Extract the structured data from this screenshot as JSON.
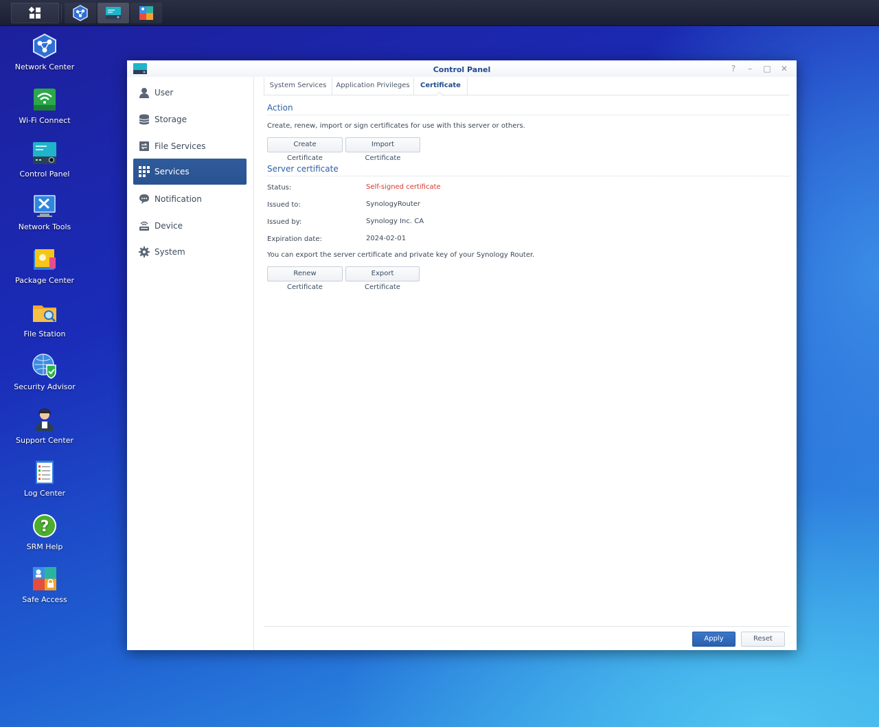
{
  "taskbar": {
    "items": [
      {
        "name": "main-menu"
      },
      {
        "name": "network-center"
      },
      {
        "name": "control-panel"
      },
      {
        "name": "safe-access"
      }
    ]
  },
  "desktop": {
    "icons": [
      {
        "label": "Network Center",
        "icon": "network-center-icon"
      },
      {
        "label": "Wi-Fi Connect",
        "icon": "wifi-connect-icon"
      },
      {
        "label": "Control Panel",
        "icon": "control-panel-icon"
      },
      {
        "label": "Network Tools",
        "icon": "network-tools-icon"
      },
      {
        "label": "Package Center",
        "icon": "package-center-icon"
      },
      {
        "label": "File Station",
        "icon": "file-station-icon"
      },
      {
        "label": "Security Advisor",
        "icon": "security-advisor-icon"
      },
      {
        "label": "Support Center",
        "icon": "support-center-icon"
      },
      {
        "label": "Log Center",
        "icon": "log-center-icon"
      },
      {
        "label": "SRM Help",
        "icon": "srm-help-icon"
      },
      {
        "label": "Safe Access",
        "icon": "safe-access-icon"
      }
    ]
  },
  "window": {
    "title": "Control Panel",
    "controls": {
      "help": "?",
      "minimize": "–",
      "maximize": "□",
      "close": "✕"
    }
  },
  "sidebar": {
    "items": [
      {
        "label": "User",
        "icon": "user-icon"
      },
      {
        "label": "Storage",
        "icon": "storage-icon"
      },
      {
        "label": "File Services",
        "icon": "file-services-icon"
      },
      {
        "label": "Services",
        "icon": "services-icon",
        "active": true
      },
      {
        "label": "Notification",
        "icon": "notification-icon"
      },
      {
        "label": "Device",
        "icon": "device-icon"
      },
      {
        "label": "System",
        "icon": "system-icon"
      }
    ]
  },
  "tabs": [
    {
      "label": "System Services"
    },
    {
      "label": "Application Privileges"
    },
    {
      "label": "Certificate",
      "active": true
    }
  ],
  "action": {
    "title": "Action",
    "description": "Create, renew, import or sign certificates for use with this server or others.",
    "create_button": "Create Certificate",
    "import_button": "Import Certificate"
  },
  "server_certificate": {
    "title": "Server certificate",
    "rows": [
      {
        "label": "Status:",
        "value": "Self-signed certificate"
      },
      {
        "label": "Issued to:",
        "value": "SynologyRouter"
      },
      {
        "label": "Issued by:",
        "value": "Synology Inc. CA"
      },
      {
        "label": "Expiration date:",
        "value": "2024-02-01"
      }
    ],
    "export_note": "You can export the server certificate and private key of your Synology Router.",
    "renew_button": "Renew Certificate",
    "export_button": "Export Certificate"
  },
  "footer": {
    "apply_button": "Apply",
    "reset_button": "Reset"
  },
  "colors": {
    "accent": "#2b5797",
    "title": "#22488f",
    "section": "#2c5ea8",
    "warning": "#d6382c"
  }
}
